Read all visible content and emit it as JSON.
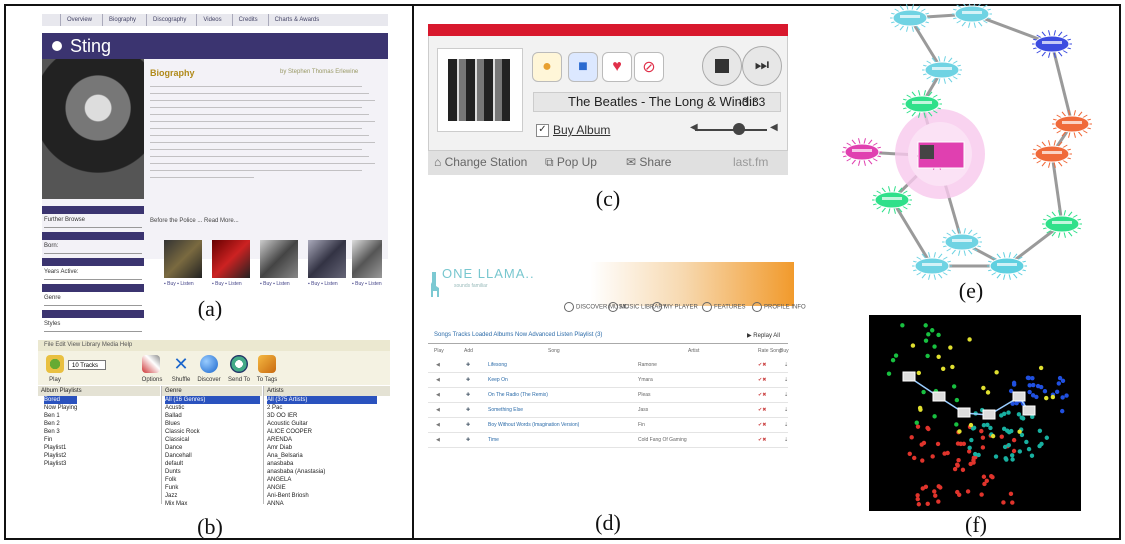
{
  "labels": {
    "a": "(a)",
    "b": "(b)",
    "c": "(c)",
    "d": "(d)",
    "e": "(e)",
    "f": "(f)"
  },
  "panel_a": {
    "tabs": [
      "Overview",
      "Biography",
      "Discography",
      "Videos",
      "Credits",
      "Charts & Awards"
    ],
    "artist": "Sting",
    "bio_title": "Biography",
    "bio_author": "by Stephen Thomas Erlewine",
    "bio_lines": 14,
    "more_link": "Before the Police ... Read More...",
    "sidebar": [
      "Further Browse",
      "Born:",
      "Years Active:",
      "Genre",
      "Styles"
    ]
  },
  "panel_b": {
    "menu": "File  Edit  View  Library  Media  Help",
    "select_value": "10 Tracks",
    "toolbar": [
      "Play",
      "Options",
      "Shuffle",
      "Discover",
      "Send To",
      "To Tags"
    ],
    "col_headers": [
      "Album Playlists",
      "Genre",
      "Artists"
    ],
    "playlists": [
      "Bored",
      "Now Playing",
      "Ben 1",
      "Ben 2",
      "Ben 3",
      "Fin",
      "Playlist1",
      "Playlist2",
      "Playlist3"
    ],
    "genres": [
      "All (16 Genres)",
      "Acustic",
      "Ballad",
      "Blues",
      "Classic Rock",
      "Classical",
      "Dance",
      "Dancehall",
      "default",
      "Dunts",
      "Folk",
      "Funk",
      "Jazz",
      "Mix Max"
    ],
    "artists": [
      "All (375 Artists)",
      "2 Pac",
      "3D OO IER",
      "Acoustic Guitar",
      "ALICE COOPER",
      "ARENDA",
      "Amr Diab",
      "Ana_Belsaria",
      "anasbaba",
      "anasbaba (Anastasia)",
      "ANGELA",
      "ANGIE",
      "Ani-Bent Briosh",
      "ANNA"
    ]
  },
  "panel_c": {
    "track": "The Beatles - The Long & Windir",
    "time": "-3:33",
    "buy_album": "Buy Album",
    "footer": [
      "Change Station",
      "Pop Up",
      "Share"
    ],
    "brand": "last.fm",
    "colors": {
      "top_bar": "#d8182d"
    }
  },
  "panel_d": {
    "logo": "ONE LLAMA..",
    "sub": "sounds familiar",
    "nav": [
      "DISCOVER MUSIC",
      "MUSIC LIBRARY",
      "MY PLAYER",
      "FEATURES",
      "PROFILE INFO"
    ],
    "tabs": "Songs  Tracks  Loaded Albums  Now  Advanced Listen  Playlist (3)",
    "replay": "Replay All",
    "headers": [
      "Play",
      "Add",
      "Song",
      "Artist",
      "Rate Song",
      "Buy"
    ],
    "rows": [
      {
        "song": "Lifesong",
        "artist": "Ramone"
      },
      {
        "song": "Keep On",
        "artist": "Ymara"
      },
      {
        "song": "On The Radio (The Remix)",
        "artist": "Pleas"
      },
      {
        "song": "Something Else",
        "artist": "Jass"
      },
      {
        "song": "Boy Without Words (Imagination Version)",
        "artist": "Fin"
      },
      {
        "song": "Time",
        "artist": "Cold Fang Of Gaming"
      }
    ]
  },
  "panel_e": {
    "node_colors": [
      "#6fd3e3",
      "#3c4ce0",
      "#f06a3a",
      "#e040b0",
      "#2fe08a",
      "#5fd0e0"
    ]
  },
  "panel_f": {
    "point_colors": [
      "#e0342c",
      "#18b0a0",
      "#2050e0",
      "#e0e030",
      "#18c040"
    ]
  }
}
